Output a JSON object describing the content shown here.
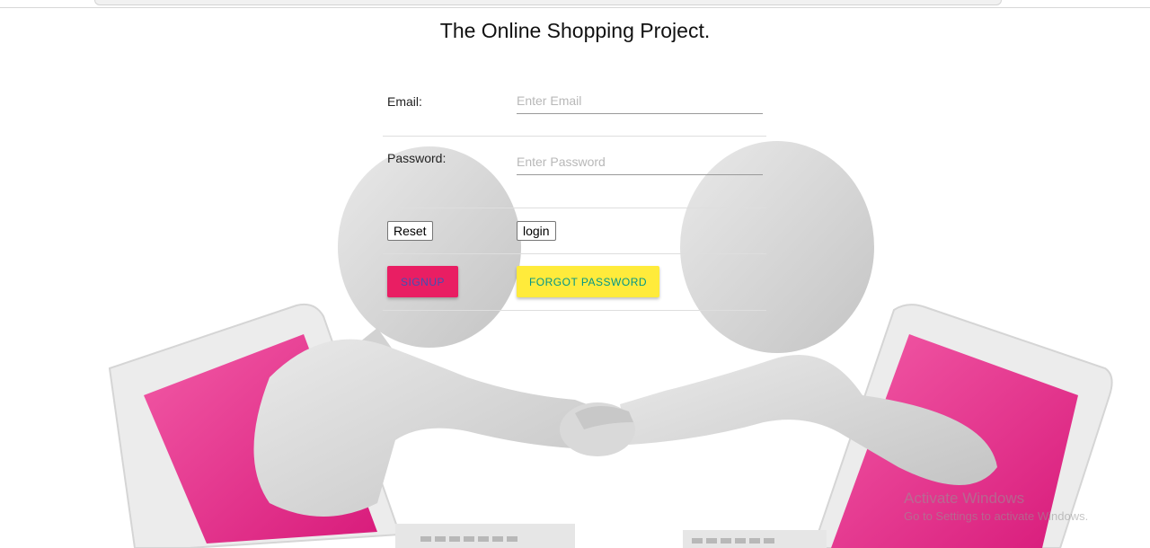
{
  "page": {
    "title": "The Online Shopping Project."
  },
  "form": {
    "email": {
      "label": "Email:",
      "placeholder": "Enter Email",
      "value": ""
    },
    "password": {
      "label": "Password:",
      "placeholder": "Enter Password",
      "value": ""
    },
    "reset_label": "Reset",
    "login_label": "login",
    "signup_label": "SIGNUP",
    "forgot_label": "FORGOT PASSWORD"
  },
  "watermark": {
    "title": "Activate Windows",
    "subtitle": "Go to Settings to activate Windows."
  },
  "colors": {
    "signup_bg": "#e91e63",
    "signup_text": "#3f51b5",
    "forgot_bg": "#ffeb3b",
    "forgot_text": "#009688",
    "laptop_screen": "#e8388f"
  },
  "background": {
    "illustration": "two-figures-shaking-hands-through-laptops"
  }
}
